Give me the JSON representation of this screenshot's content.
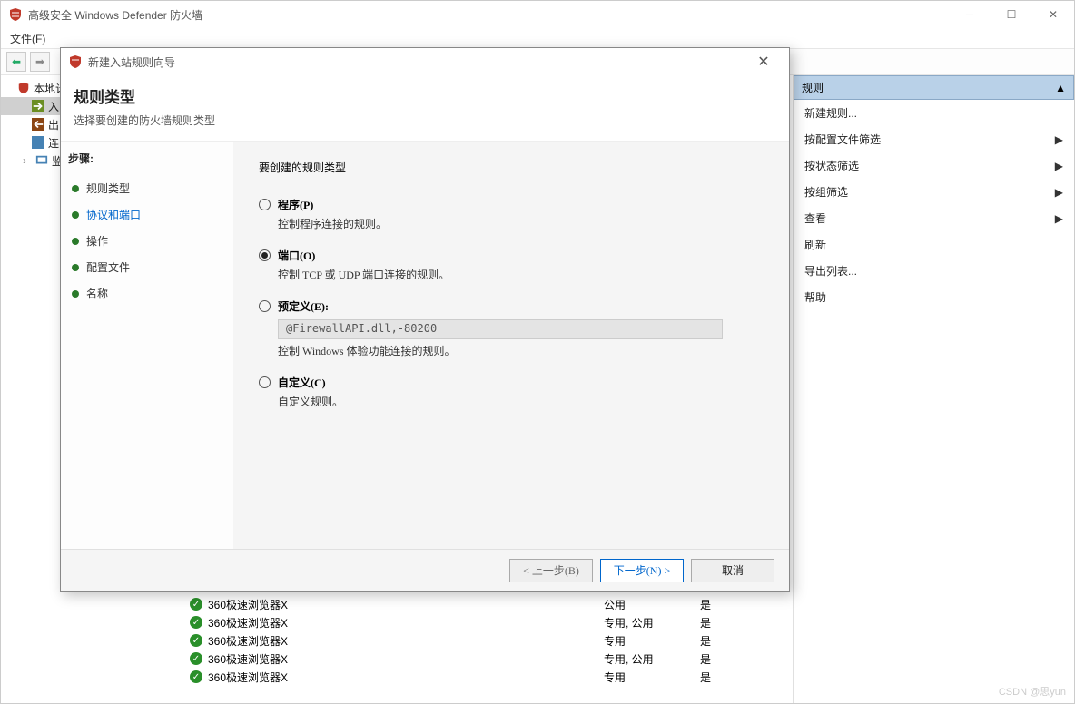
{
  "main_window": {
    "title": "高级安全 Windows Defender 防火墙",
    "menu": {
      "file": "文件(F)"
    },
    "tree": {
      "root": "本地计",
      "inbound": "入",
      "outbound": "出",
      "conn": "连",
      "monitor": "监"
    },
    "rules": [
      {
        "name": "360极速浏览器X",
        "profile": "公用",
        "enabled": "是"
      },
      {
        "name": "360极速浏览器X",
        "profile": "专用, 公用",
        "enabled": "是"
      },
      {
        "name": "360极速浏览器X",
        "profile": "专用",
        "enabled": "是"
      },
      {
        "name": "360极速浏览器X",
        "profile": "专用, 公用",
        "enabled": "是"
      },
      {
        "name": "360极速浏览器X",
        "profile": "专用",
        "enabled": "是"
      }
    ],
    "actions": {
      "header": "规则",
      "items": [
        {
          "label": "新建规则...",
          "arrow": false
        },
        {
          "label": "按配置文件筛选",
          "arrow": true
        },
        {
          "label": "按状态筛选",
          "arrow": true
        },
        {
          "label": "按组筛选",
          "arrow": true
        },
        {
          "label": "查看",
          "arrow": true
        },
        {
          "label": "刷新",
          "arrow": false
        },
        {
          "label": "导出列表...",
          "arrow": false
        },
        {
          "label": "帮助",
          "arrow": false
        }
      ]
    }
  },
  "wizard": {
    "title": "新建入站规则向导",
    "heading": "规则类型",
    "subheading": "选择要创建的防火墙规则类型",
    "steps_label": "步骤:",
    "steps": [
      {
        "label": "规则类型",
        "current": true
      },
      {
        "label": "协议和端口",
        "link": true
      },
      {
        "label": "操作"
      },
      {
        "label": "配置文件"
      },
      {
        "label": "名称"
      }
    ],
    "prompt": "要创建的规则类型",
    "options": {
      "program": {
        "label": "程序(P)",
        "desc": "控制程序连接的规则。"
      },
      "port": {
        "label": "端口(O)",
        "desc": "控制 TCP 或 UDP 端口连接的规则。"
      },
      "predefined": {
        "label": "预定义(E):",
        "combo": "@FirewallAPI.dll,-80200",
        "desc": "控制 Windows 体验功能连接的规则。"
      },
      "custom": {
        "label": "自定义(C)",
        "desc": "自定义规则。"
      }
    },
    "selected": "port",
    "buttons": {
      "back": "< 上一步(B)",
      "next": "下一步(N) >",
      "cancel": "取消"
    }
  },
  "watermark": "CSDN @思yun"
}
